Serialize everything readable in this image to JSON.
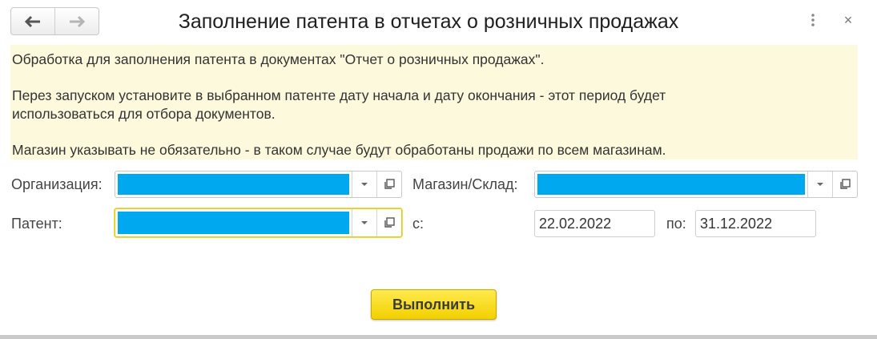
{
  "window": {
    "title": "Заполнение патента в отчетах о розничных продажах",
    "back_icon": "arrow-left-icon",
    "forward_icon": "arrow-right-icon",
    "menu_icon": "more-vertical-icon",
    "close_glyph": "×"
  },
  "info": {
    "line1": "Обработка для заполнения патента в документах \"Отчет о розничных продажах\".",
    "line2": "Перез запуском установите в выбранном патенте дату начала и дату окончания - этот период будет",
    "line3": "использоваться для отбора документов.",
    "line4": "Магазин указывать не обязательно - в таком случае будут обработаны продажи по всем магазинам.",
    "background": "#fcf9dc"
  },
  "form": {
    "organization_label": "Организация:",
    "store_label": "Магазин/Склад:",
    "patent_label": "Патент:",
    "from_label": "с:",
    "to_label": "по:",
    "date_from": "22.02.2022",
    "date_to": "31.12.2022",
    "selection_color": "#00a8ef"
  },
  "actions": {
    "run_label": "Выполнить",
    "accent": "#f5d400"
  }
}
